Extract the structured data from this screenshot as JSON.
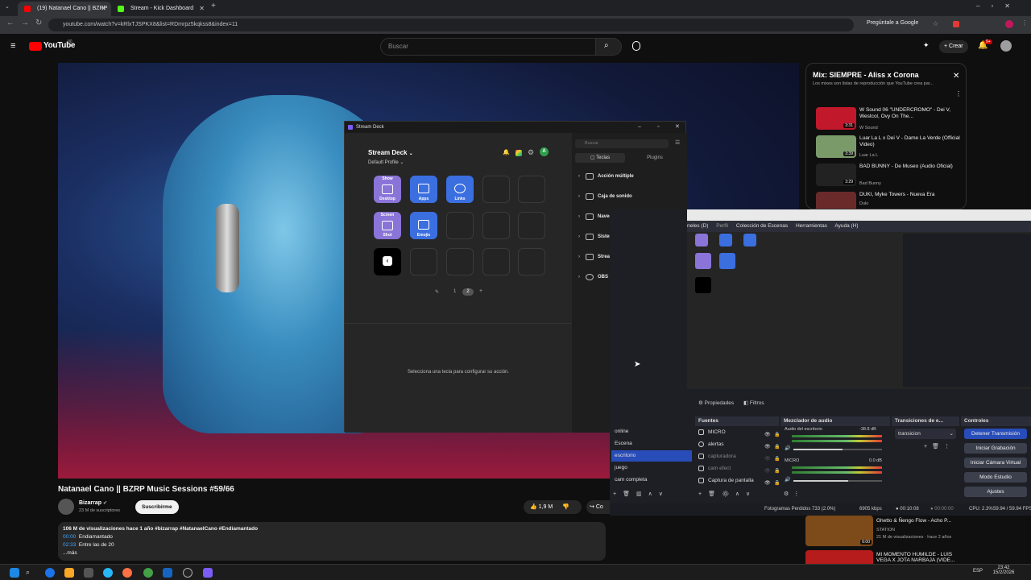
{
  "browser": {
    "tabs": [
      {
        "label": "(19) Natanael Cano || BZRP",
        "favicon_color": "#ff0000"
      },
      {
        "label": "Stream - Kick Dashboard",
        "favicon_color": "#53fc18"
      }
    ],
    "new_tab": "+",
    "url": "youtube.com/watch?v=kRlxTJSPKX8&list=RDmrpz5kqkss8&index=11",
    "ask_google": "Pregúntale a Google"
  },
  "youtube": {
    "logo": "YouTube",
    "logo_sup": "90",
    "search_placeholder": "Buscar",
    "create": "Crear",
    "notif_count": "9+",
    "video_title": "Natanael Cano || BZRP Music Sessions #59/66",
    "channel": "Bizarrap",
    "subs": "23 M de suscriptores",
    "subscribe": "Suscribirme",
    "likes": "1,9 M",
    "share": "Co",
    "description": {
      "meta": "106 M de visualizaciones  hace 1 año  #bizarrap #NatanaelCano #Endiamantado",
      "chapters": [
        {
          "time": "00:00",
          "label": "Endiamantado"
        },
        {
          "time": "02:33",
          "label": "Entre las de 20"
        }
      ],
      "more": "...más"
    },
    "playlist": {
      "title": "Mix: SIEMPRE - Aliss x Corona",
      "subtitle": "Los mixes son listas de reproducción que YouTube crea par...",
      "items": [
        {
          "title": "W Sound 06 \"UNDERCROMO\" - Dei V, Westcol, Ovy On The...",
          "channel": "W Sound",
          "duration": "3:31",
          "color": "#c2182b"
        },
        {
          "title": "Luar La L x Dei V - Dame La Verde (Official Video)",
          "channel": "Luar La L",
          "duration": "3:39",
          "color": "#7a9a6a"
        },
        {
          "title": "BAD BUNNY - De Museo (Audio Oficial)",
          "channel": "Bad Bunny",
          "duration": "3:29",
          "color": "#222222"
        },
        {
          "title": "DUKI, Myke Towers - Nueva Era",
          "channel": "Duki",
          "duration": "",
          "color": "#6a2a2a"
        }
      ]
    },
    "recommended": [
      {
        "title": "Ghetto & Ñengo Flow - Acho P...",
        "meta1": "STATION",
        "meta2": "21 M de visualizaciones · hace 2 años",
        "duration": "6:00"
      },
      {
        "title": "MI MOMENTO HUMILDE - LUIS VEGA X JOTA NARBAJA (VIDE...",
        "meta1": "",
        "meta2": "",
        "duration": ""
      }
    ]
  },
  "stream_deck": {
    "window_title": "Stream Deck",
    "app_title": "Stream Deck",
    "profile": "Default Profile",
    "avatar_letter": "A",
    "keys": [
      {
        "top": "Show",
        "label": "Desktop",
        "color": "#8a74d8"
      },
      {
        "top": "",
        "label": "Apps",
        "color": "#3b6fe0"
      },
      {
        "top": "",
        "label": "Links",
        "color": "#3b6fe0"
      },
      {
        "top": "Screen",
        "label": "Shot",
        "color": "#8a74d8"
      },
      {
        "top": "",
        "label": "Emojis",
        "color": "#3b6fe0"
      }
    ],
    "pages": [
      "1",
      "2"
    ],
    "empty_hint": "Selecciona una tecla para configurar su acción.",
    "search_placeholder": "Buscar",
    "tabs": [
      "Teclas",
      "Plugins"
    ],
    "categories": [
      "Acción múltiple",
      "Caja de sonido",
      "Navegación",
      "Sistema",
      "Stream Deck",
      "OBS Studio"
    ]
  },
  "obs": {
    "menu": [
      "neles (D)",
      "Perfil",
      "Colección de Escenas",
      "Herramientas",
      "Ayuda (H)"
    ],
    "props_tab": "Propiedades",
    "filters_tab": "Filtros",
    "scenes": [
      "online",
      "Escena",
      "escritorio",
      "juego",
      "cam completa"
    ],
    "sources_title": "Fuentes",
    "sources": [
      "MICRO",
      "alertas",
      "capturadora",
      "cam efect",
      "Captura de pantalla"
    ],
    "mixer_title": "Mezclador de audio",
    "mixer": [
      {
        "name": "Audio del escritorio",
        "db": "-38.8 dB",
        "level": 0.55
      },
      {
        "name": "MICRO",
        "db": "0.0 dB",
        "level": 0.62
      }
    ],
    "transitions_title": "Transiciones de e...",
    "transition_value": "transicion",
    "controls_title": "Controles",
    "controls": [
      "Detener Transmisión",
      "Iniciar Grabación",
      "Iniciar Cámara Virtual",
      "Modo Estudio",
      "Ajustes"
    ],
    "status": {
      "dropped": "Fotogramas Perdidos 733 (2.0%)",
      "bitrate": "6905 kbps",
      "live": "00:10:08",
      "rec": "00:00:00",
      "cpu": "CPU: 2.3%",
      "fps": "59.94 / 59.94 FPS"
    }
  },
  "taskbar": {
    "lang": "ESP",
    "time": "23:42",
    "date": "15/2/2026"
  }
}
